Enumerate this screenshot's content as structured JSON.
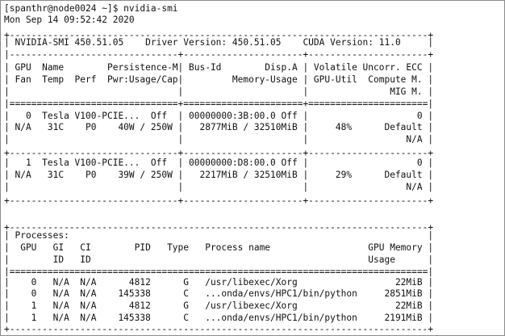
{
  "terminal": {
    "prompt": "[spanthr@node0024 ~]$ nvidia-smi",
    "lines": [
      "[spanthr@node0024 ~]$ nvidia-smi",
      "Mon Sep 14 09:52:42 2020",
      "+-----------------------------------------------------------------------------+",
      "| NVIDIA-SMI 450.51.05    Driver Version: 450.51.05    CUDA Version: 11.0     |",
      "|-------------------------------+----------------------+----------------------+",
      "| GPU  Name        Persistence-M| Bus-Id        Disp.A | Volatile Uncorr. ECC |",
      "| Fan  Temp  Perf  Pwr:Usage/Cap|         Memory-Usage | GPU-Util  Compute M. |",
      "|                               |                      |               MIG M. |",
      "|===============================+======================+======================|",
      "|   0  Tesla V100-PCIE...  Off  | 00000000:3B:00.0 Off |                    0 |",
      "| N/A   31C    P0    40W / 250W |   2877MiB / 32510MiB |     48%      Default |",
      "|                               |                      |                  N/A |",
      "+-------------------------------+----------------------+----------------------+",
      "|   1  Tesla V100-PCIE...  Off  | 00000000:D8:00.0 Off |                    0 |",
      "| N/A   31C    P0    39W / 250W |   2217MiB / 32510MiB |     29%      Default |",
      "|                               |                      |                  N/A |",
      "+-------------------------------+----------------------+----------------------+",
      "",
      "+-----------------------------------------------------------------------------+",
      "| Processes:                                                                  |",
      "|  GPU   GI   CI        PID   Type   Process name                  GPU Memory |",
      "|        ID   ID                                                   Usage      |",
      "|=============================================================================|",
      "|    0   N/A  N/A      4812      G   /usr/libexec/Xorg                  22MiB |",
      "|    0   N/A  N/A    145338      C   ...onda/envs/HPC1/bin/python     2851MiB |",
      "|    1   N/A  N/A      4812      G   /usr/libexec/Xorg                  22MiB |",
      "|    1   N/A  N/A    145338      C   ...onda/envs/HPC1/bin/python     2191MiB |",
      "+-----------------------------------------------------------------------------+"
    ]
  },
  "smi": {
    "version": "450.51.05",
    "driver_version": "450.51.05",
    "cuda_version": "11.0",
    "timestamp": "Mon Sep 14 09:52:42 2020"
  },
  "gpus": [
    {
      "index": "0",
      "name": "Tesla V100-PCIE...",
      "persistence": "Off",
      "bus_id": "00000000:3B:00.0",
      "disp": "Off",
      "ecc": "0",
      "fan": "N/A",
      "temp": "31C",
      "perf": "P0",
      "power": "40W / 250W",
      "memory": "2877MiB / 32510MiB",
      "util": "48%",
      "compute": "Default",
      "mig": "N/A"
    },
    {
      "index": "1",
      "name": "Tesla V100-PCIE...",
      "persistence": "Off",
      "bus_id": "00000000:D8:00.0",
      "disp": "Off",
      "ecc": "0",
      "fan": "N/A",
      "temp": "31C",
      "perf": "P0",
      "power": "39W / 250W",
      "memory": "2217MiB / 32510MiB",
      "util": "29%",
      "compute": "Default",
      "mig": "N/A"
    }
  ],
  "processes": [
    {
      "gpu": "0",
      "gi": "N/A",
      "ci": "N/A",
      "pid": "4812",
      "type": "G",
      "name": "/usr/libexec/Xorg",
      "memory": "22MiB"
    },
    {
      "gpu": "0",
      "gi": "N/A",
      "ci": "N/A",
      "pid": "145338",
      "type": "C",
      "name": "...onda/envs/HPC1/bin/python",
      "memory": "2851MiB"
    },
    {
      "gpu": "1",
      "gi": "N/A",
      "ci": "N/A",
      "pid": "4812",
      "type": "G",
      "name": "/usr/libexec/Xorg",
      "memory": "22MiB"
    },
    {
      "gpu": "1",
      "gi": "N/A",
      "ci": "N/A",
      "pid": "145338",
      "type": "C",
      "name": "...onda/envs/HPC1/bin/python",
      "memory": "2191MiB"
    }
  ]
}
